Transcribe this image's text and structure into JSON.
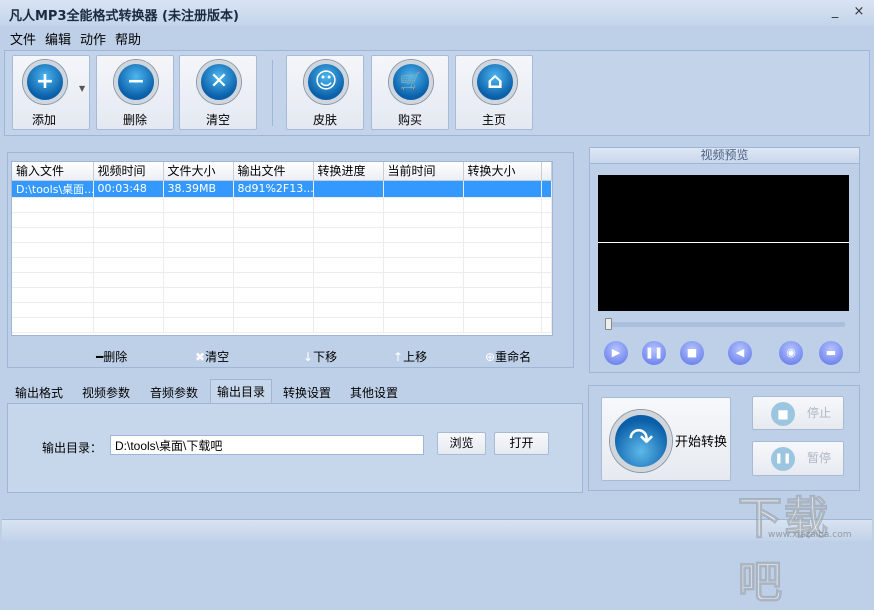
{
  "window": {
    "title": "凡人MP3全能格式转换器  (未注册版本)",
    "minimize": "_",
    "close": "×"
  },
  "menu": [
    "文件",
    "编辑",
    "动作",
    "帮助"
  ],
  "toolbar": [
    {
      "label": "添加",
      "icon": "plus-icon"
    },
    {
      "label": "删除",
      "icon": "minus-icon"
    },
    {
      "label": "清空",
      "icon": "x-icon"
    },
    {
      "label": "皮肤",
      "icon": "smiley-icon"
    },
    {
      "label": "购买",
      "icon": "cart-icon"
    },
    {
      "label": "主页",
      "icon": "home-icon"
    }
  ],
  "file_table": {
    "columns": [
      "输入文件",
      "视频时间",
      "文件大小",
      "输出文件",
      "转换进度",
      "当前时间",
      "转换大小"
    ],
    "rows": [
      [
        "D:\\tools\\桌面...",
        "00:03:48",
        "38.39MB",
        "8d91%2F13...",
        "",
        "",
        ""
      ]
    ]
  },
  "list_actions": {
    "delete": "删除",
    "clear": "清空",
    "move_down": "下移",
    "move_up": "上移",
    "rename": "重命名"
  },
  "tabs": [
    "输出格式",
    "视频参数",
    "音频参数",
    "输出目录",
    "转换设置",
    "其他设置"
  ],
  "active_tab": "输出目录",
  "output_dir": {
    "label": "输出目录：",
    "value": "D:\\tools\\桌面\\下载吧",
    "browse": "浏览",
    "open": "打开"
  },
  "preview": {
    "title": "视频预览",
    "progress": 0
  },
  "convert": {
    "start": "开始转换",
    "stop": "停止",
    "pause": "暂停"
  },
  "watermark": {
    "text": "下载吧",
    "url": "www.xiazaiba.com"
  },
  "colors": {
    "background": "#bed0e8",
    "selection": "#3399ff",
    "accent": "#0a5fa8"
  }
}
